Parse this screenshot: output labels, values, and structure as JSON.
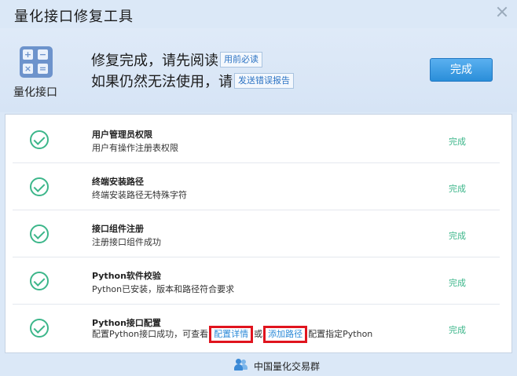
{
  "window": {
    "title": "量化接口修复工具"
  },
  "header": {
    "app_label": "量化接口",
    "line1_text": "修复完成，请先阅读",
    "line1_button": "用前必读",
    "line2_text": "如果仍然无法使用，请",
    "line2_button": "发送错误报告",
    "done_button": "完成"
  },
  "rows": [
    {
      "title": "用户管理员权限",
      "desc": "用户有操作注册表权限",
      "status": "完成"
    },
    {
      "title": "终端安装路径",
      "desc": "终端安装路径无特殊字符",
      "status": "完成"
    },
    {
      "title": "接口组件注册",
      "desc": "注册接口组件成功",
      "status": "完成"
    },
    {
      "title": "Python软件校验",
      "desc": "Python已安装，版本和路径符合要求",
      "status": "完成"
    },
    {
      "title": "Python接口配置",
      "desc_prefix": "配置Python接口成功，可查看",
      "link1": "配置详情",
      "desc_middle": "或",
      "link2": "添加路径",
      "desc_suffix": "配置指定Python",
      "status": "完成"
    }
  ],
  "footer": {
    "group_label": "中国量化交易群",
    "icon": "qq-group-icon"
  },
  "colors": {
    "accent": "#2a8ed9",
    "success": "#3cb68a",
    "highlight_border": "#e0141e"
  }
}
